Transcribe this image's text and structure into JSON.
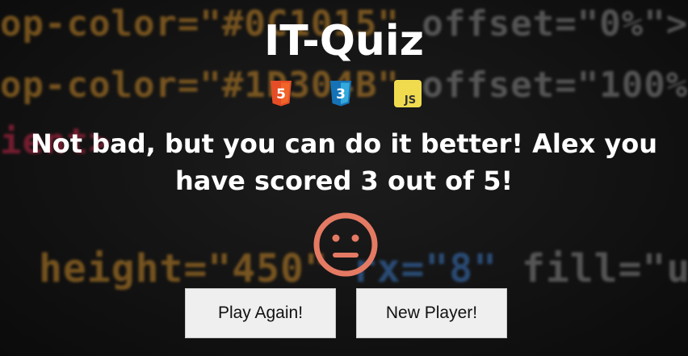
{
  "app": {
    "title": "IT-Quiz"
  },
  "logos": {
    "html": {
      "icon": "html5-icon",
      "number": "5",
      "color": "#e44d26"
    },
    "css": {
      "icon": "css3-icon",
      "number": "3",
      "color": "#2a9fd6"
    },
    "js": {
      "icon": "javascript-icon",
      "label": "JS",
      "color": "#f0db4f"
    }
  },
  "result": {
    "message": "Not bad, but you can do it better! Alex you have scored 3 out of 5!",
    "face_icon": "neutral-face-icon",
    "face_color": "#e47a63"
  },
  "actions": {
    "play_again_label": "Play Again!",
    "new_player_label": "New Player!"
  },
  "background": {
    "lines": [
      [
        "op-color=\"#0C1015\"",
        " offset=\"0%\">"
      ],
      [
        "op-color=\"#1D304B\"",
        " offset=\"100%"
      ],
      [
        "ient>"
      ],
      [
        "height=\"450\"",
        " rx=\"8\"",
        " fill=\"url"
      ]
    ]
  }
}
